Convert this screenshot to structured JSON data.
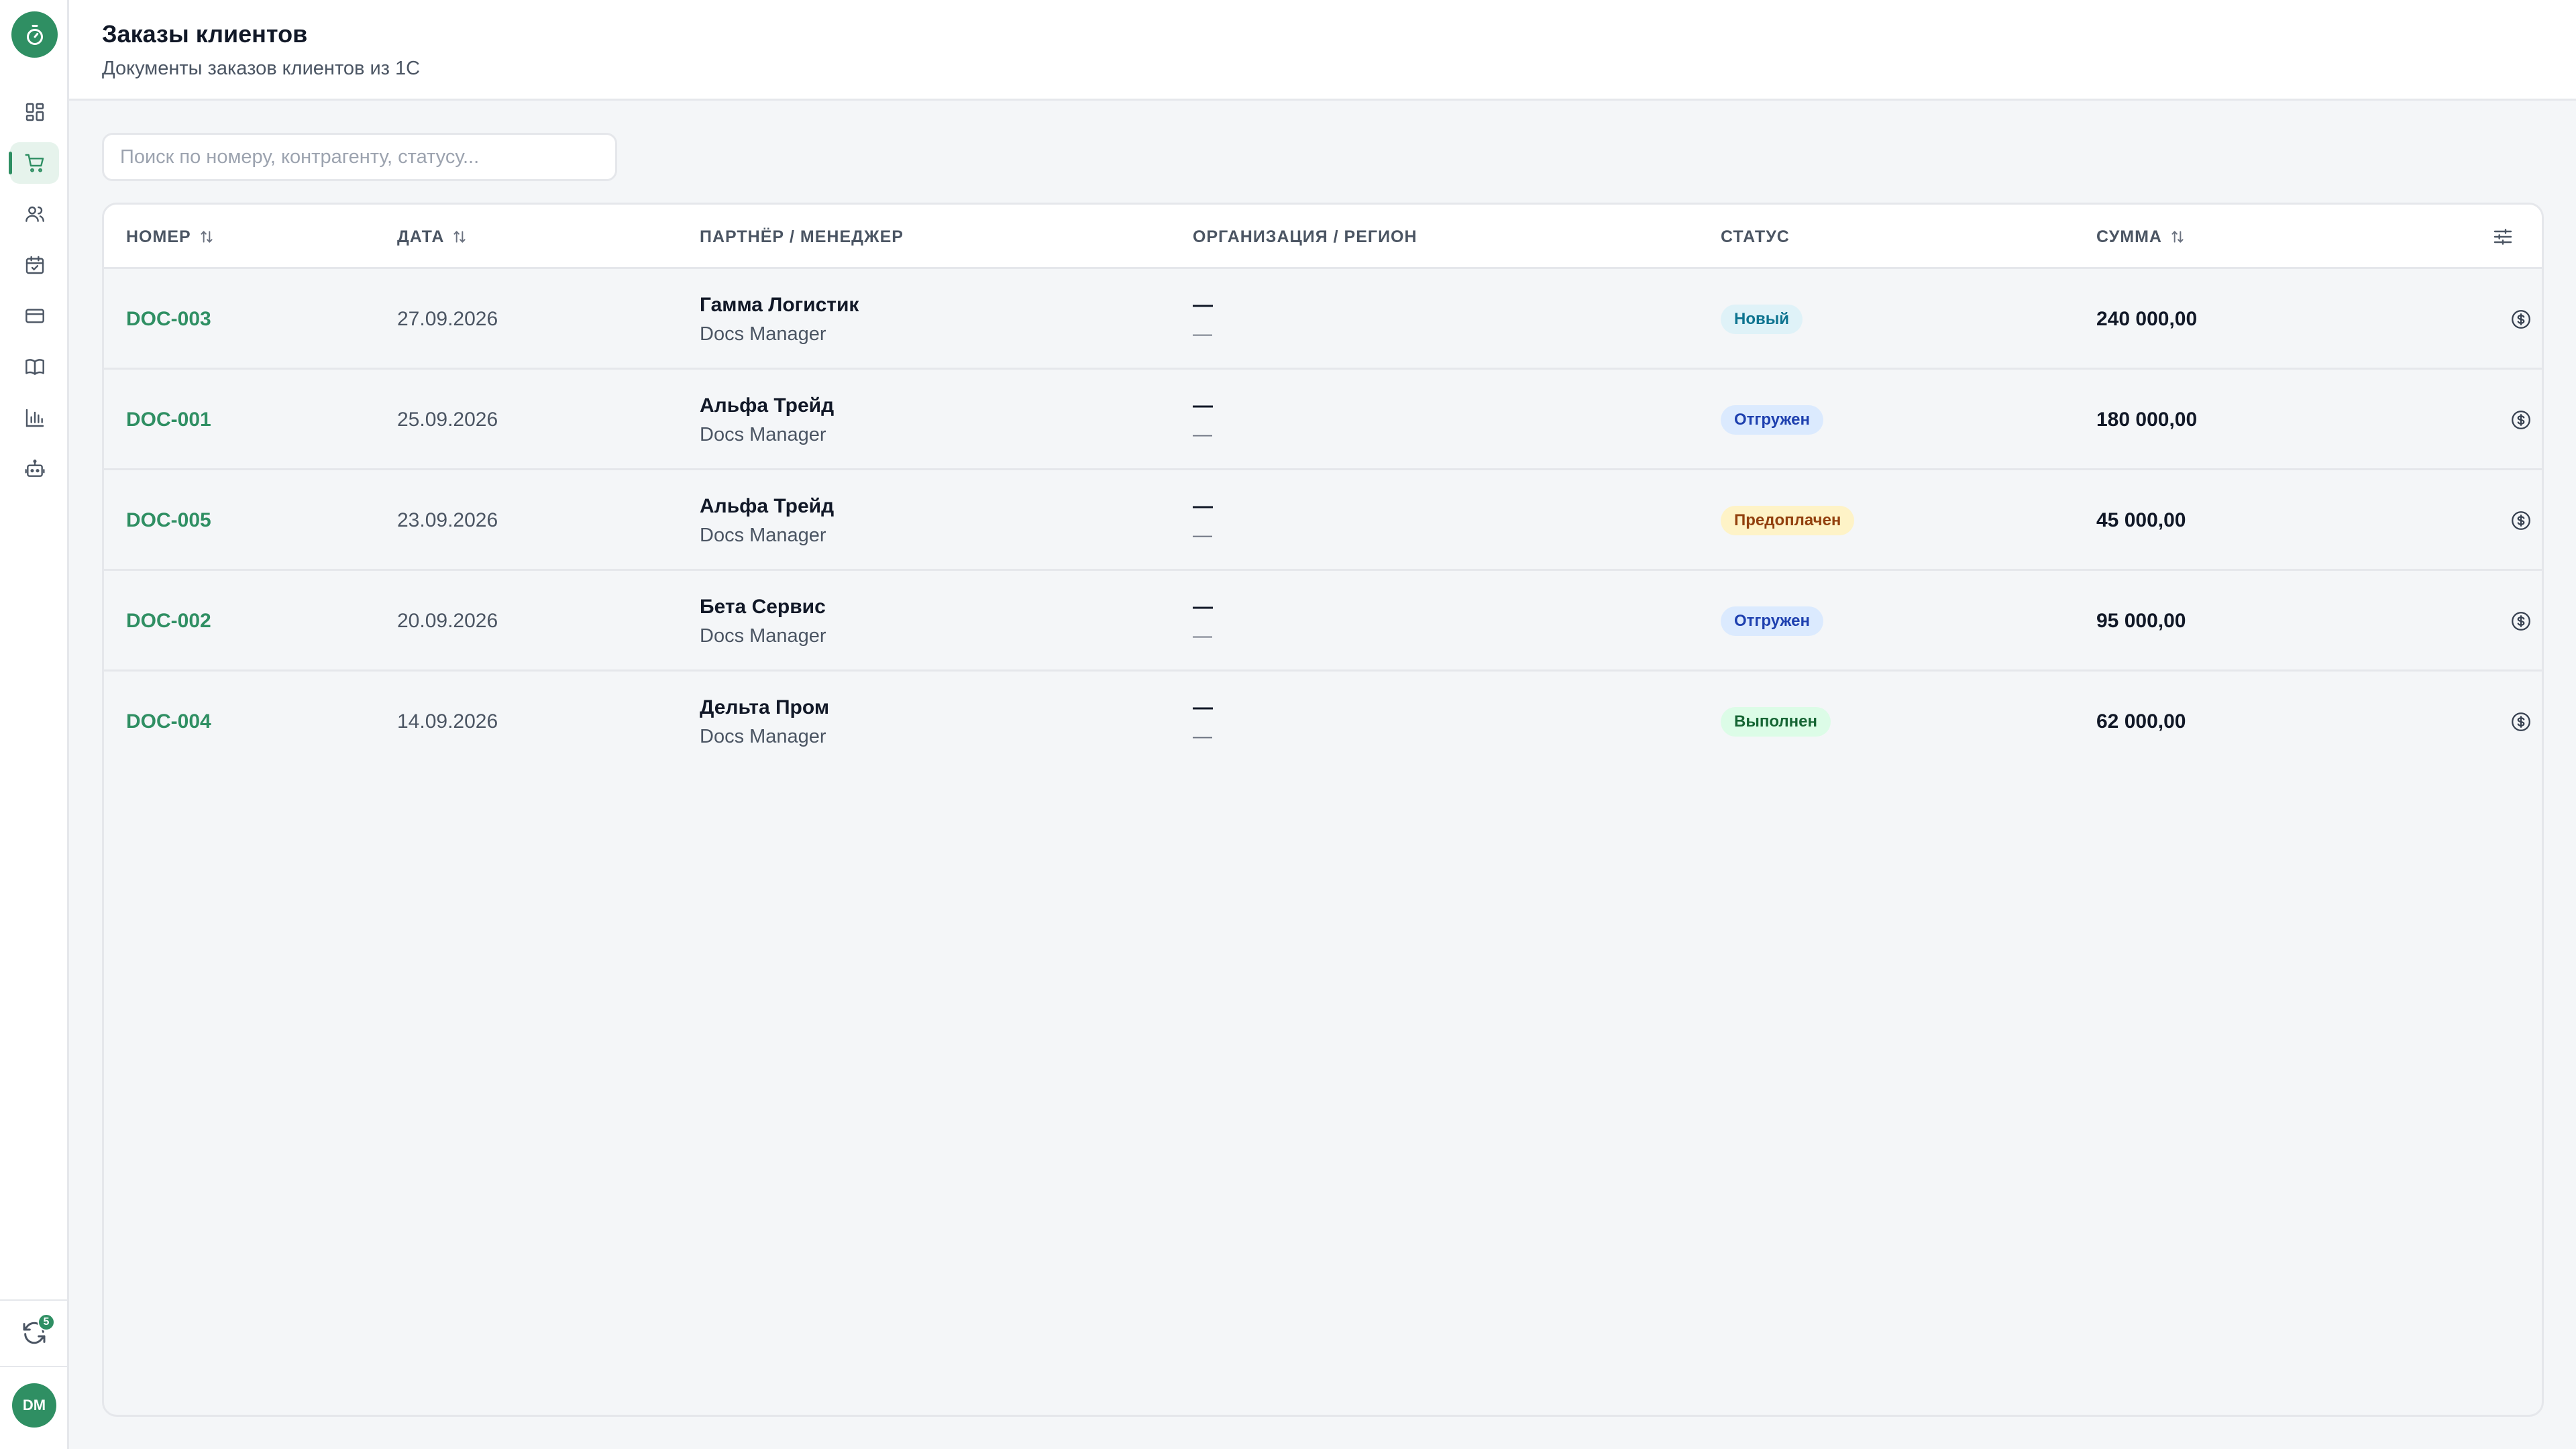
{
  "app": {
    "sync_badge_count": "5",
    "user_initials": "DM",
    "accent_color": "#2f8f63"
  },
  "sidebar": {
    "items": [
      {
        "icon": "dashboard-icon",
        "active": false
      },
      {
        "icon": "cart-icon",
        "active": true
      },
      {
        "icon": "users-icon",
        "active": false
      },
      {
        "icon": "calendar-icon",
        "active": false
      },
      {
        "icon": "card-icon",
        "active": false
      },
      {
        "icon": "book-icon",
        "active": false
      },
      {
        "icon": "bar-chart-icon",
        "active": false
      },
      {
        "icon": "bot-icon",
        "active": false
      }
    ]
  },
  "header": {
    "title": "Заказы клиентов",
    "subtitle": "Документы заказов клиентов из 1С"
  },
  "search": {
    "placeholder": "Поиск по номеру, контрагенту, статусу...",
    "value": ""
  },
  "table": {
    "columns": {
      "number": "НОМЕР",
      "date": "ДАТА",
      "partner": "ПАРТНЁР / МЕНЕДЖЕР",
      "org": "ОРГАНИЗАЦИЯ / РЕГИОН",
      "status": "СТАТУС",
      "sum": "СУММА"
    },
    "rows": [
      {
        "number": "DOC-003",
        "date": "27.09.2026",
        "partner": "Гамма Логистик",
        "manager": "Docs Manager",
        "org": "—",
        "region": "—",
        "status": "Новый",
        "status_kind": "new",
        "sum": "240 000,00"
      },
      {
        "number": "DOC-001",
        "date": "25.09.2026",
        "partner": "Альфа Трейд",
        "manager": "Docs Manager",
        "org": "—",
        "region": "—",
        "status": "Отгружен",
        "status_kind": "shipped",
        "sum": "180 000,00"
      },
      {
        "number": "DOC-005",
        "date": "23.09.2026",
        "partner": "Альфа Трейд",
        "manager": "Docs Manager",
        "org": "—",
        "region": "—",
        "status": "Предоплачен",
        "status_kind": "prepaid",
        "sum": "45 000,00"
      },
      {
        "number": "DOC-002",
        "date": "20.09.2026",
        "partner": "Бета Сервис",
        "manager": "Docs Manager",
        "org": "—",
        "region": "—",
        "status": "Отгружен",
        "status_kind": "shipped",
        "sum": "95 000,00"
      },
      {
        "number": "DOC-004",
        "date": "14.09.2026",
        "partner": "Дельта Пром",
        "manager": "Docs Manager",
        "org": "—",
        "region": "—",
        "status": "Выполнен",
        "status_kind": "done",
        "sum": "62 000,00"
      }
    ]
  },
  "status_colors": {
    "new": {
      "bg": "#dff2f8",
      "fg": "#0e7490"
    },
    "shipped": {
      "bg": "#dbeafe",
      "fg": "#1e40af"
    },
    "prepaid": {
      "bg": "#fef3c7",
      "fg": "#92400e"
    },
    "done": {
      "bg": "#dcfce7",
      "fg": "#166534"
    }
  }
}
